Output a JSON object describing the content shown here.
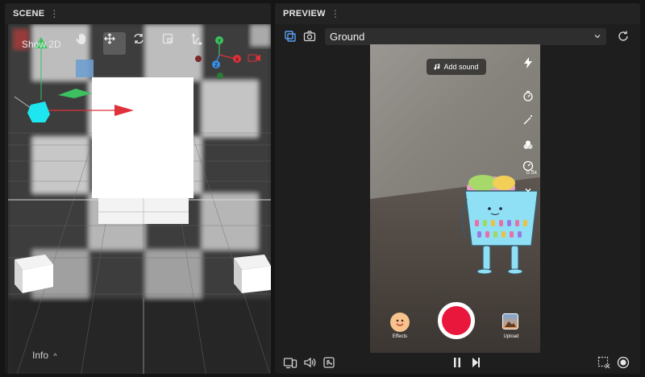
{
  "scene": {
    "title": "SCENE",
    "menu_glyph": "⋮",
    "show2d_label": "Show 2D",
    "info_label": "Info",
    "info_caret": "^",
    "tools": [
      "hand-icon",
      "move-icon",
      "rotate-icon",
      "scale-icon",
      "pivot-icon"
    ],
    "gizmo": {
      "y_label": "Y",
      "z_label": "Z",
      "x_label": "X"
    }
  },
  "preview": {
    "title": "PREVIEW",
    "menu_glyph": "⋮",
    "dropdown_value": "Ground",
    "add_sound_label": "Add sound",
    "zoom_label": "0.5x",
    "effects_label": "Effects",
    "upload_label": "Upload"
  },
  "colors": {
    "accent_red": "#e8173b",
    "gizmo_red": "#e0303a",
    "gizmo_green": "#3cc060",
    "gizmo_blue": "#3a8ee0",
    "cyan_object": "#1ee6f0",
    "panel_bg": "#1e1e1e"
  }
}
